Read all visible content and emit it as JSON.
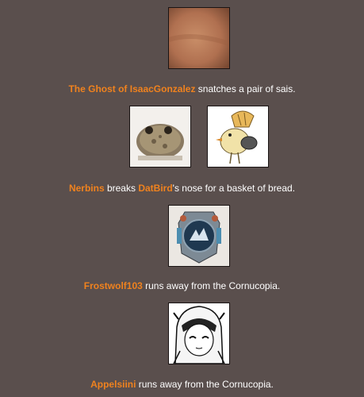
{
  "events": [
    {
      "tributes": [
        {
          "name": "The Ghost of IsaacGonzalez",
          "avatar": "skin-closeup-image"
        }
      ],
      "parts": [
        {
          "type": "name",
          "text": "The Ghost of IsaacGonzalez"
        },
        {
          "type": "text",
          "text": " snatches a pair of sais."
        }
      ]
    },
    {
      "tributes": [
        {
          "name": "Nerbins",
          "avatar": "frog-image"
        },
        {
          "name": "DatBird",
          "avatar": "bird-image"
        }
      ],
      "parts": [
        {
          "type": "name",
          "text": "Nerbins"
        },
        {
          "type": "text",
          "text": " breaks "
        },
        {
          "type": "name",
          "text": "DatBird"
        },
        {
          "type": "text",
          "text": "'s nose for a basket of bread."
        }
      ]
    },
    {
      "tributes": [
        {
          "name": "Frostwolf103",
          "avatar": "emblem-image"
        }
      ],
      "parts": [
        {
          "type": "name",
          "text": "Frostwolf103"
        },
        {
          "type": "text",
          "text": " runs away from the Cornucopia."
        }
      ]
    },
    {
      "tributes": [
        {
          "name": "Appelsiini",
          "avatar": "manga-girl-image"
        }
      ],
      "parts": [
        {
          "type": "name",
          "text": "Appelsiini"
        },
        {
          "type": "text",
          "text": " runs away from the Cornucopia."
        }
      ]
    }
  ],
  "colors": {
    "background": "#5a4f4d",
    "tribute_name": "#f0821e",
    "text": "#ffffff"
  }
}
